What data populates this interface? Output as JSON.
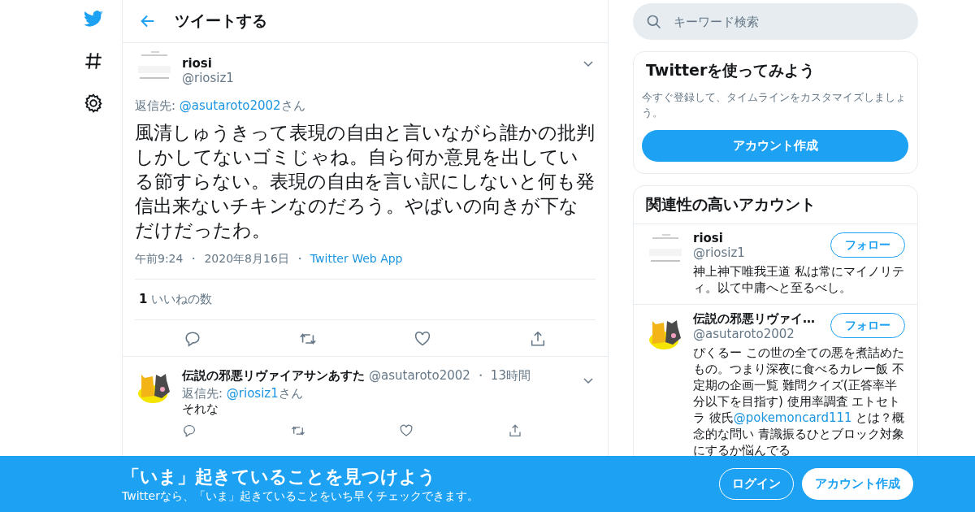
{
  "nav": [
    {
      "kind": "bird"
    },
    {
      "kind": "hash"
    },
    {
      "kind": "gear"
    }
  ],
  "header": {
    "title": "ツイートする"
  },
  "tweet": {
    "name": "riosi",
    "handle": "@riosiz1",
    "avatar": {
      "kind": "picture"
    },
    "reply_to": [
      {
        "kind": "text",
        "text": "返信先: "
      },
      {
        "kind": "link",
        "text": "@asutaroto2002"
      },
      {
        "kind": "text",
        "text": "さん"
      }
    ],
    "body": "風清しゅうきって表現の自由と言いながら誰かの批判しかしてないゴミじゃね。自ら何か意見を出している節すらない。表現の自由を言い訳にしないと何も発信出来ないチキンなのだろう。やばいの向きが下なだけだったわ。",
    "meta": [
      {
        "kind": "text",
        "text": "午前9:24"
      },
      {
        "kind": "separator",
        "text": "・"
      },
      {
        "kind": "text",
        "text": "2020年8月16日"
      },
      {
        "kind": "separator",
        "text": "・"
      },
      {
        "kind": "link",
        "text": "Twitter Web App"
      }
    ],
    "likes_count": "1",
    "likes_label": "いいねの数"
  },
  "replies": [
    {
      "name": "伝説の邪悪リヴァイアサンあすた",
      "handle": "@asutaroto2002",
      "separator": "・",
      "time": "13時間",
      "avatar": {
        "kind": "picture"
      },
      "reply_to": [
        {
          "kind": "text",
          "text": "返信先: "
        },
        {
          "kind": "link",
          "text": "@riosiz1"
        },
        {
          "kind": "text",
          "text": "さん"
        }
      ],
      "body": "それな"
    }
  ],
  "search": {
    "placeholder": "キーワード検索"
  },
  "signup_card": {
    "title": "Twitterを使ってみよう",
    "text": "今すぐ登録して、タイムラインをカスタマイズしましょう。",
    "button": "アカウント作成"
  },
  "related": {
    "title": "関連性の高いアカウント",
    "accounts": [
      {
        "name": "riosi",
        "handle": "@riosiz1",
        "avatar": {
          "kind": "picture"
        },
        "button": "フォロー",
        "bio": [
          {
            "kind": "text",
            "text": "神上神下唯我王道 私は常にマイノリティ。以て中庸へと至るべし。"
          }
        ]
      },
      {
        "name": "伝説の邪悪リヴァイ…",
        "handle": "@asutaroto2002",
        "avatar": {
          "kind": "picture"
        },
        "button": "フォロー",
        "bio": [
          {
            "kind": "text",
            "text": "ぴくるー この世の全ての悪を煮詰めたもの。つまり深夜に食べるカレー飯 不定期の企画一覧 難問クイズ(正答率半分以下を目指す) 使用率調査 エトセトラ 彼氏"
          },
          {
            "kind": "link",
            "text": "@pokemoncard111"
          },
          {
            "kind": "text",
            "text": " とは？概念的な問い 青識振るひとブロック対象にするか悩んでる"
          }
        ]
      }
    ]
  },
  "banner": {
    "title": "「いま」起きていることを見つけよう",
    "subtitle": "Twitterなら、「いま」起きていることをいち早くチェックできます。",
    "login": "ログイン",
    "signup": "アカウント作成"
  }
}
